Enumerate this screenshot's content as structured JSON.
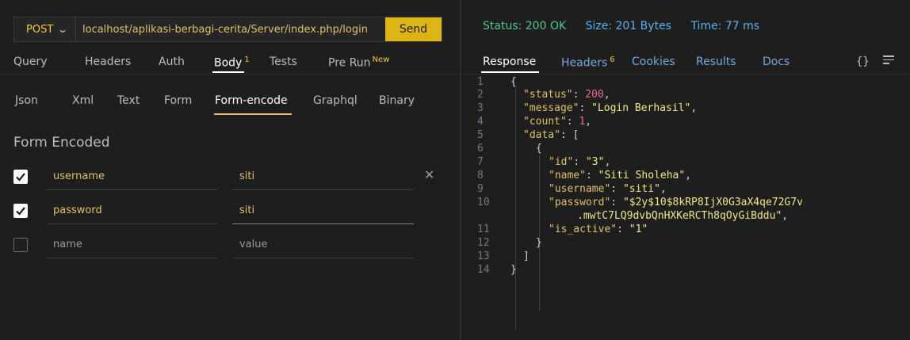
{
  "request": {
    "method": "POST",
    "url": "localhost/aplikasi-berbagi-cerita/Server/index.php/login",
    "send_label": "Send"
  },
  "tabs": {
    "query": "Query",
    "headers": "Headers",
    "auth": "Auth",
    "body": "Body",
    "body_count": "1",
    "tests": "Tests",
    "prerun": "Pre Run",
    "prerun_badge": "New"
  },
  "body_tabs": {
    "json": "Json",
    "xml": "Xml",
    "text": "Text",
    "form": "Form",
    "form_encode": "Form-encode",
    "graphql": "Graphql",
    "binary": "Binary"
  },
  "form": {
    "title": "Form Encoded",
    "rows": [
      {
        "checked": true,
        "key": "username",
        "value": "siti"
      },
      {
        "checked": true,
        "key": "password",
        "value": "siti"
      },
      {
        "checked": false,
        "key_placeholder": "name",
        "value_placeholder": "value"
      }
    ]
  },
  "response_status": {
    "status": "Status: 200 OK",
    "size": "Size: 201 Bytes",
    "time": "Time: 77 ms"
  },
  "response_tabs": {
    "response": "Response",
    "headers": "Headers",
    "headers_count": "6",
    "cookies": "Cookies",
    "results": "Results",
    "docs": "Docs",
    "braces_icon": "{}"
  },
  "code": {
    "line_numbers": [
      "1",
      "2",
      "3",
      "4",
      "5",
      "6",
      "7",
      "8",
      "9",
      "10",
      "11",
      "12",
      "13",
      "14"
    ],
    "l1": "{",
    "l2_key": "\"status\"",
    "l2_val": "200",
    "l3_key": "\"message\"",
    "l3_val": "\"Login Berhasil\"",
    "l4_key": "\"count\"",
    "l4_val": "1",
    "l5_key": "\"data\"",
    "l5_open": "[",
    "l6": "{",
    "l7_key": "\"id\"",
    "l7_val": "\"3\"",
    "l8_key": "\"name\"",
    "l8_val": "\"Siti Sholeha\"",
    "l9_key": "\"username\"",
    "l9_val": "\"siti\"",
    "l10_key": "\"password\"",
    "l10_val_a": "\"$2y$10$8kRP8IjX0G3aX4qe72G7v",
    "l10_val_b": ".mwtC7LQ9dvbQnHXKeRCTh8qOyGiBddu\"",
    "l11_key": "\"is_active\"",
    "l11_val": "\"1\"",
    "l12": "}",
    "l13": "]",
    "l14": "}"
  }
}
